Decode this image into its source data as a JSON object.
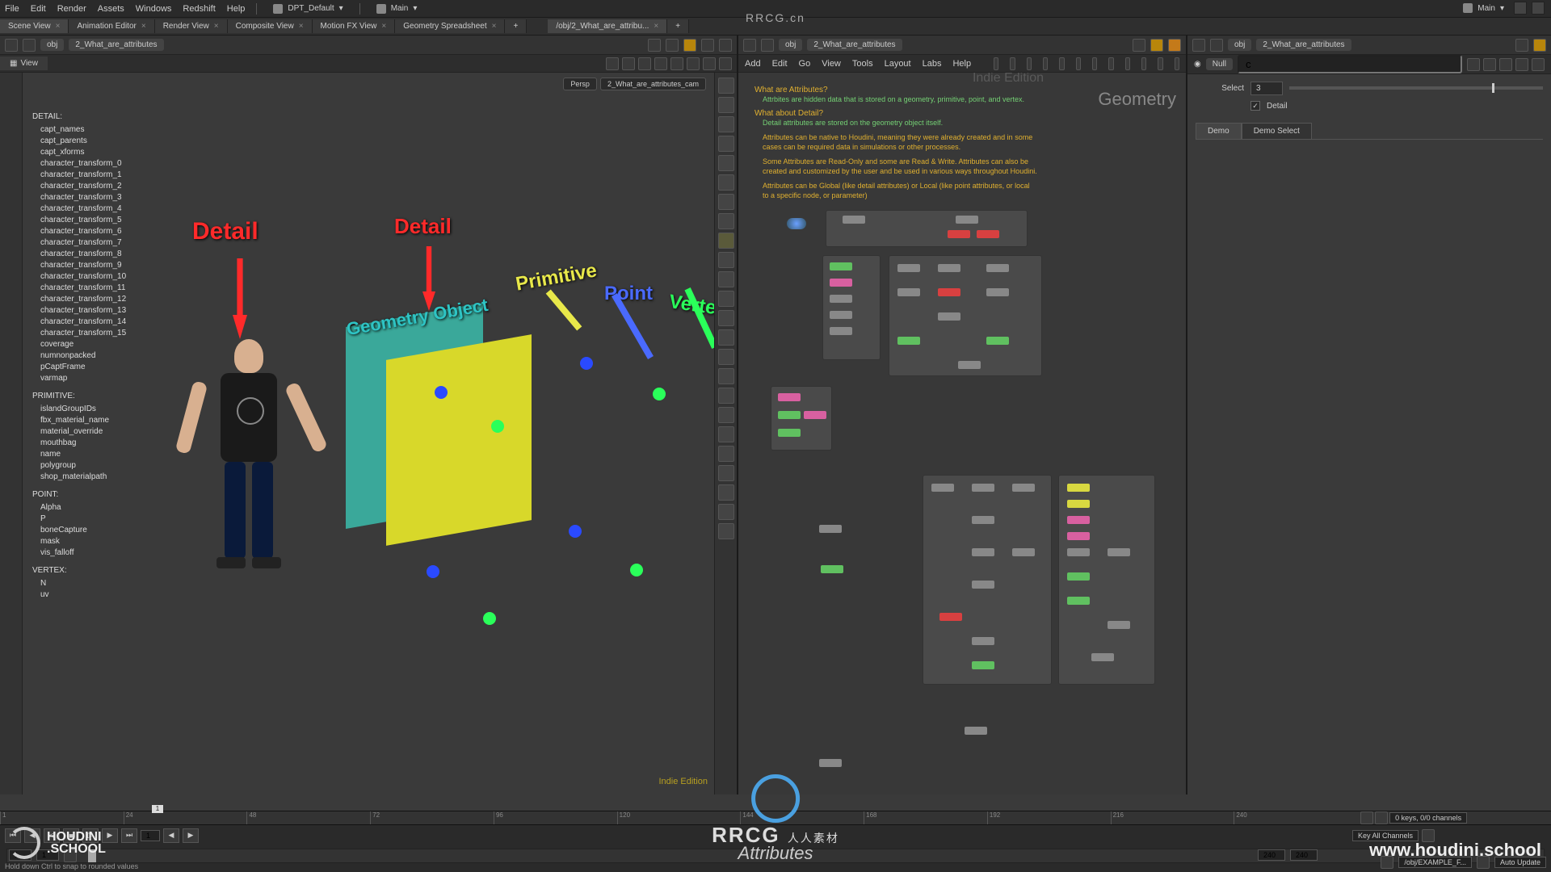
{
  "menu": {
    "items": [
      "File",
      "Edit",
      "Render",
      "Assets",
      "Windows",
      "Redshift",
      "Help"
    ],
    "shelf1": "DPT_Default",
    "shelf2": "Main",
    "desktop": "Main"
  },
  "center_brand": "RRCG.cn",
  "tabs": {
    "left": [
      "Scene View",
      "Animation Editor",
      "Render View",
      "Composite View",
      "Motion FX View",
      "Geometry Spreadsheet"
    ],
    "mid": "/obj/2_What_are_attribu...",
    "right": ""
  },
  "path": {
    "root": "obj",
    "node": "2_What_are_attributes"
  },
  "view": {
    "label": "View",
    "cam_left": "Persp",
    "cam_right": "2_What_are_attributes_cam"
  },
  "attrs": {
    "detail_head": "DETAIL:",
    "detail": [
      "capt_names",
      "capt_parents",
      "capt_xforms",
      "character_transform_0",
      "character_transform_1",
      "character_transform_2",
      "character_transform_3",
      "character_transform_4",
      "character_transform_5",
      "character_transform_6",
      "character_transform_7",
      "character_transform_8",
      "character_transform_9",
      "character_transform_10",
      "character_transform_11",
      "character_transform_12",
      "character_transform_13",
      "character_transform_14",
      "character_transform_15",
      "coverage",
      "numnonpacked",
      "pCaptFrame",
      "varmap"
    ],
    "prim_head": "PRIMITIVE:",
    "prim": [
      "islandGroupIDs",
      "fbx_material_name",
      "material_override",
      "mouthbag",
      "name",
      "polygroup",
      "shop_materialpath"
    ],
    "point_head": "POINT:",
    "point": [
      "Alpha",
      "P",
      "boneCapture",
      "mask",
      "vis_falloff"
    ],
    "vertex_head": "VERTEX:",
    "vertex": [
      "N",
      "uv"
    ]
  },
  "overlay": {
    "detail": "Detail",
    "geo": "Geometry Object",
    "prim": "Primitive",
    "point": "Point",
    "vert": "Vertex",
    "indie": "Indie Edition"
  },
  "net_menu": [
    "Add",
    "Edit",
    "Go",
    "View",
    "Tools",
    "Layout",
    "Labs",
    "Help"
  ],
  "info": {
    "indie": "Indie Edition",
    "geo": "Geometry",
    "q1": "What are Attributes?",
    "a1": "Attrbites are hidden data that is stored on a geometry, primitive, point, and vertex.",
    "q2": "What about Detail?",
    "a2": "Detail attributes are stored on the geometry object itself.",
    "a3": "Attributes can be native to Houdini, meaning they were already created and in some cases can be required data in simulations or other processes.",
    "a4": "Some Attributes are Read-Only and some are Read & Write. Attributes can also be created and customized by the user and be used in various ways throughout Houdini.",
    "a5": "Attributes can be Global (like detail attributes) or Local (like point attributes, or local to a specific node, or parameter)"
  },
  "parm": {
    "type": "Null",
    "name": "c",
    "select_label": "Select",
    "select_val": "3",
    "detail_label": "Detail",
    "tabs": [
      "Demo",
      "Demo Select"
    ]
  },
  "timeline": {
    "ticks": [
      "1",
      "24",
      "48",
      "72",
      "96",
      "120",
      "144",
      "168",
      "192",
      "216",
      "240"
    ],
    "badge": "1",
    "start": "1",
    "cur": "1",
    "end": "240",
    "end2": "240",
    "status": "Hold down Ctrl to snap to rounded values",
    "keys": "0 keys, 0/0 channels",
    "keymode": "Key All Channels",
    "scope": "/obj/EXAMPLE_F...",
    "update": "Auto Update"
  },
  "wm": {
    "hs1": "HOUDINI",
    "hs2": ".SCHOOL",
    "brand": "RRCG",
    "brand_sub": "人人素材",
    "attr": "Attributes",
    "url": "www.houdini.school"
  }
}
